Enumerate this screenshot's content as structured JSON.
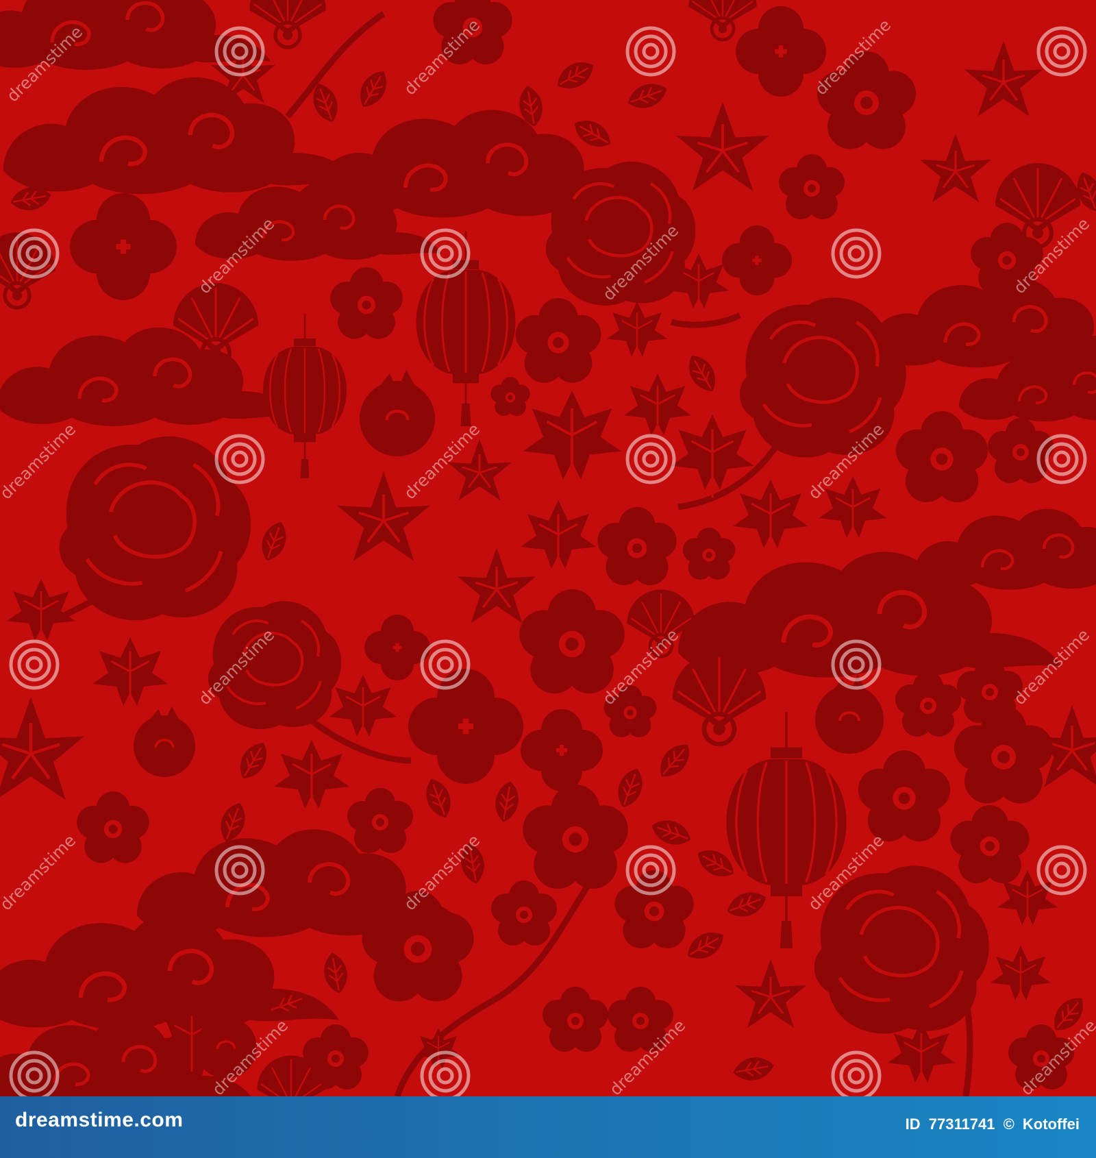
{
  "image": {
    "background_color": "#c40c0c",
    "motif_color": "#8e0606",
    "motifs": [
      "chinese-cloud",
      "peony",
      "plum-blossom",
      "cherry-blossom",
      "lantern",
      "maple-leaf",
      "fan",
      "persimmon",
      "branch"
    ]
  },
  "watermark": {
    "text": "dreamstime",
    "color": "#ffffff"
  },
  "footer": {
    "bar_colors": [
      "#1f5f9f",
      "#1a86c4"
    ],
    "site": "dreamstime.com",
    "id_label": "ID",
    "id_number": "77311741",
    "copyright_symbol": "©",
    "author": "Kotoffei"
  }
}
